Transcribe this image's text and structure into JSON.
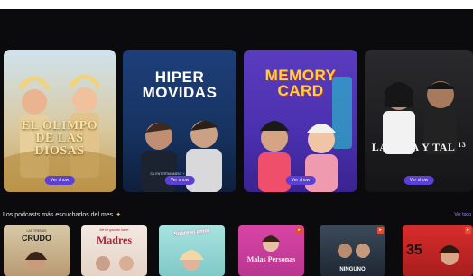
{
  "hero": {
    "cards": [
      {
        "title": "EL OLIMPO DE LAS DIOSAS",
        "button": "Ver show"
      },
      {
        "title": "HIPER MOVIDAS",
        "credits": "SU ENTERTAINMENT + SALVEN AMIGO",
        "button": "Ver show"
      },
      {
        "title": "MEMORY CARD",
        "button": "Ver show"
      },
      {
        "title": "LA VIDA Y TAL",
        "number": "13",
        "button": "Ver show"
      }
    ]
  },
  "popular": {
    "title": "Los podcasts más escuchados del mes",
    "spark_icon": "sparkle-icon",
    "see_all": "Ver todo",
    "cards": [
      {
        "title": "CRUDO",
        "subtitle": "LAS TRENDS"
      },
      {
        "title": "Madres",
        "subtitle": "Me he ganado hacer"
      },
      {
        "title": "Sobre el amor"
      },
      {
        "title": "Malas Personas"
      },
      {
        "title": "NINGUNO"
      },
      {
        "title": "35"
      }
    ]
  },
  "colors": {
    "background": "#0b0b0d",
    "accent_button": "#5b3fd6",
    "link": "#9a8cff",
    "spark": "#f5c640"
  }
}
